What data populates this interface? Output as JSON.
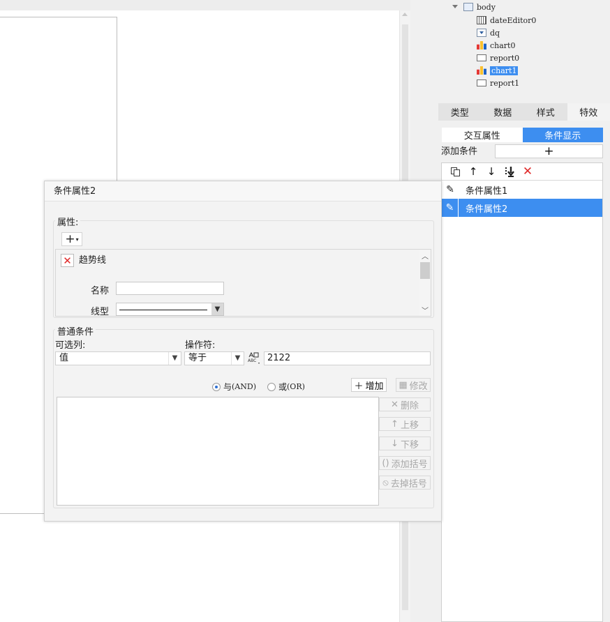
{
  "tree": {
    "items": [
      {
        "label": "body",
        "icon": "body-icon"
      },
      {
        "label": "dateEditor0",
        "icon": "calendar-icon"
      },
      {
        "label": "dq",
        "icon": "dropdown-icon"
      },
      {
        "label": "chart0",
        "icon": "chart-icon"
      },
      {
        "label": "report0",
        "icon": "report-icon"
      },
      {
        "label": "chart1",
        "icon": "chart-icon",
        "selected": true
      },
      {
        "label": "report1",
        "icon": "report-icon"
      }
    ]
  },
  "tabs": [
    "类型",
    "数据",
    "样式",
    "特效"
  ],
  "active_tab": "特效",
  "subtabs": {
    "interaction": "交互属性",
    "condition": "条件显示"
  },
  "add_condition": {
    "label": "添加条件",
    "plus": "+"
  },
  "cond_toolbar": {
    "copy": "copy-icon",
    "up": "↑",
    "down": "↓",
    "bottom": "move-bottom-icon",
    "delete": "✕"
  },
  "conditions": [
    "条件属性1",
    "条件属性2"
  ],
  "dialog": {
    "title": "条件属性2",
    "attr_group": "属性:",
    "attr_add": "+",
    "attr_item": "趋势线",
    "name_label": "名称",
    "name_value": "",
    "linetype_label": "线型",
    "normal_group": "普通条件",
    "column_label": "可选列:",
    "column_value": "值",
    "operator_label": "操作符:",
    "operator_value": "等于",
    "value": "2122",
    "and_label": "与",
    "and_code": "(AND)",
    "or_label": "或",
    "or_code": "(OR)",
    "add_btn": "增加",
    "modify_btn": "修改",
    "delete_btn": "删除",
    "up_btn": "上移",
    "down_btn": "下移",
    "add_paren_btn": "添加括号",
    "remove_paren_btn": "去掉括号"
  },
  "colors": {
    "accent": "#3d8ef0",
    "danger": "#e02a2a"
  }
}
